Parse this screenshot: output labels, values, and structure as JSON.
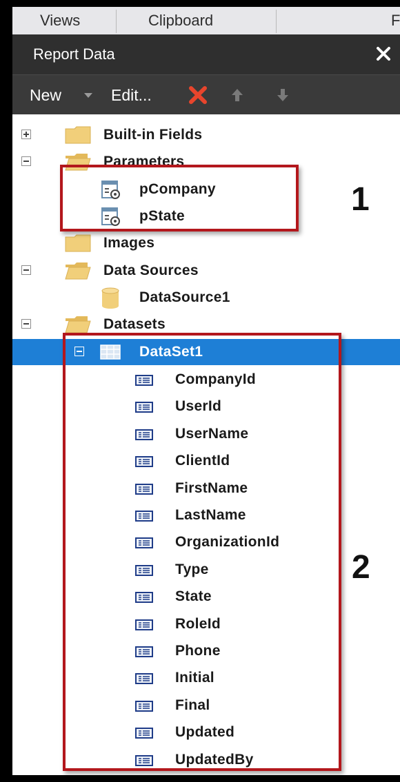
{
  "ribbon": {
    "tabs": [
      "Views",
      "Clipboard",
      "F"
    ]
  },
  "panel": {
    "title": "Report Data"
  },
  "toolbar": {
    "new_label": "New",
    "edit_label": "Edit..."
  },
  "tree": {
    "built_in_fields": "Built-in Fields",
    "parameters": "Parameters",
    "param_items": [
      "pCompany",
      "pState"
    ],
    "images": "Images",
    "data_sources": "Data Sources",
    "data_source_items": [
      "DataSource1"
    ],
    "datasets": "Datasets",
    "dataset_name": "DataSet1",
    "fields": [
      "CompanyId",
      "UserId",
      "UserName",
      "ClientId",
      "FirstName",
      "LastName",
      "OrganizationId",
      "Type",
      "State",
      "RoleId",
      "Phone",
      "Initial",
      "Final",
      "Updated",
      "UpdatedBy"
    ]
  },
  "annotations": {
    "marker_1": "1",
    "marker_2": "2"
  },
  "colors": {
    "selection": "#1e7fd6",
    "delete": "#e8452c",
    "annotation_box": "#b3171c",
    "folder": "#f1cf7a"
  },
  "icons": {
    "field": "field-icon",
    "folder": "folder-icon",
    "parameter": "parameter-icon",
    "datasource": "database-icon",
    "dataset": "table-icon"
  }
}
